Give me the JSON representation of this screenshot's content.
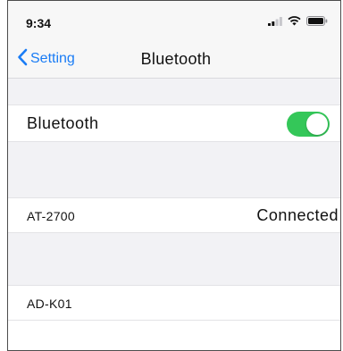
{
  "status_bar": {
    "time": "9:34",
    "icons": [
      "cellular-signal-icon",
      "wifi-icon",
      "battery-icon"
    ]
  },
  "nav": {
    "back_label": "Setting",
    "title": "Bluetooth"
  },
  "bluetooth_cell": {
    "label": "Bluetooth",
    "enabled": true
  },
  "devices": [
    {
      "name": "AT-2700",
      "status": "Connected"
    },
    {
      "name": "AD-K01",
      "status": ""
    }
  ],
  "colors": {
    "accent": "#1a7cf5",
    "toggle_on": "#34c759",
    "grouped_background": "#f2f2f5"
  }
}
